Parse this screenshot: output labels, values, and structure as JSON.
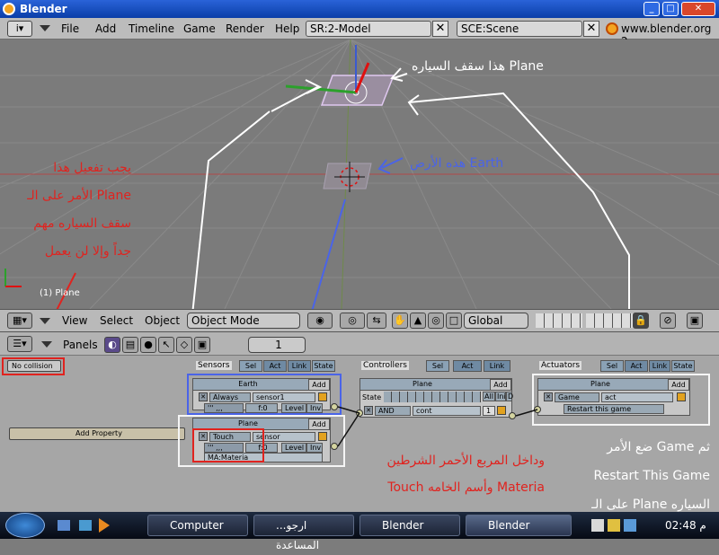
{
  "window": {
    "title": "Blender"
  },
  "menu": {
    "items": [
      "File",
      "Add",
      "Timeline",
      "Game",
      "Render",
      "Help"
    ],
    "screen": "SR:2-Model",
    "scene": "SCE:Scene",
    "website": "www.blender.org 2"
  },
  "viewport": {
    "object_label": "(1) Plane",
    "annotations": {
      "plane_roof": "هذا سقف السياره Plane",
      "earth_ground": "هذه الأرض Earth",
      "left_lines": [
        "يجب تفعيل هذا",
        "الأمر على الـ Plane",
        "سقف السياره مهم",
        "جداً وإلا لن يعمل"
      ]
    }
  },
  "view_toolbar": {
    "view": "View",
    "select": "Select",
    "object": "Object",
    "mode": "Object Mode",
    "orientation": "Global"
  },
  "logic_panel": {
    "panels_label": "Panels",
    "frame": "1",
    "collision": "No collision",
    "add_property": "Add Property",
    "sensors_label": "Sensors",
    "controllers_label": "Controllers",
    "actuators_label": "Actuators",
    "filter_buttons": [
      "Sel",
      "Act",
      "Link",
      "State"
    ],
    "ctrl_filter_buttons": [
      "Sel",
      "Act",
      "Link"
    ],
    "sensor_earth": {
      "object": "Earth",
      "add": "Add",
      "type": "Always",
      "name": "sensor1",
      "freq": "f:0",
      "level": "Level",
      "inv": "Inv"
    },
    "sensor_plane": {
      "object": "Plane",
      "add": "Add",
      "type": "Touch",
      "name": "sensor",
      "freq": "f:0",
      "level": "Level",
      "inv": "Inv",
      "material": "MA:Materia"
    },
    "controller": {
      "object": "Plane",
      "add": "Add",
      "state_label": "State",
      "all": "All",
      "ini": "Ini",
      "d": "D",
      "type": "AND",
      "name": "cont",
      "state_num": "1"
    },
    "actuator": {
      "object": "Plane",
      "add": "Add",
      "type": "Game",
      "name": "act",
      "option": "Restart this game"
    },
    "annotations": {
      "inside_red": [
        "وداخل المربع الأحمر الشرطين",
        "Touch وأسم الخامه Materia"
      ],
      "right_side": [
        "ضع الأمر Game ثم",
        "Restart This Game",
        "على الـ Plane السياره"
      ]
    }
  },
  "taskbar": {
    "tasks": [
      "Computer",
      "...ارجو المساعدة",
      "Blender",
      "Blender"
    ],
    "clock": "م 02:48"
  }
}
